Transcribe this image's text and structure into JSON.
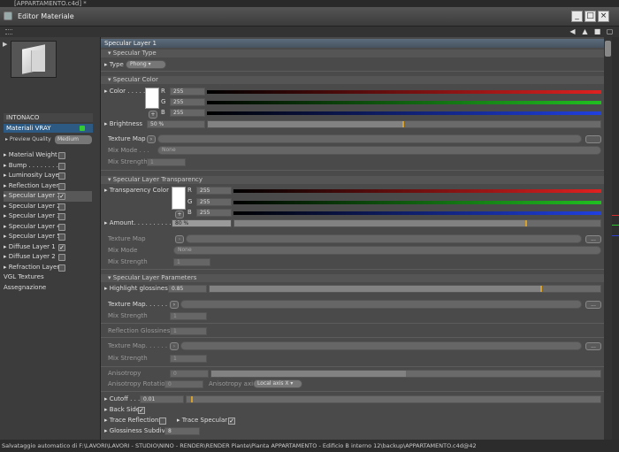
{
  "window": {
    "top_text": "[APPARTAMENTO.c4d] *",
    "title": "Editor Materiale"
  },
  "material": {
    "name": "INTONACO",
    "type_label": "Materiali VRAY",
    "preview_quality_label": "Preview Quality",
    "preview_quality_value": "Medium"
  },
  "channels": [
    {
      "label": "Material Weight",
      "checked": false
    },
    {
      "label": "Bump . . . . . . . . .",
      "checked": false
    },
    {
      "label": "Luminosity Layer",
      "checked": false
    },
    {
      "label": "Reflection Layer",
      "checked": false
    },
    {
      "label": "Specular Layer 1",
      "checked": true,
      "selected": true
    },
    {
      "label": "Specular Layer 2",
      "checked": false
    },
    {
      "label": "Specular Layer 3",
      "checked": false
    },
    {
      "label": "Specular Layer 4",
      "checked": false
    },
    {
      "label": "Specular Layer 5",
      "checked": false
    },
    {
      "label": "Diffuse Layer 1",
      "checked": true
    },
    {
      "label": "Diffuse Layer 2",
      "checked": false
    },
    {
      "label": "Refraction Layer",
      "checked": false
    },
    {
      "label": "VGL Textures",
      "checked": null
    },
    {
      "label": "Assegnazione",
      "checked": null
    }
  ],
  "main": {
    "section_title": "Specular Layer 1",
    "specular_type": {
      "header": "Specular Type",
      "label": "Type",
      "value": "Phong"
    },
    "specular_color": {
      "header": "Specular Color",
      "label": "Color . . . . . .",
      "r": "255",
      "g": "255",
      "b": "255",
      "r_lbl": "R",
      "g_lbl": "G",
      "b_lbl": "B",
      "brightness_label": "Brightness",
      "brightness": "50 %",
      "brightness_frac": 0.5,
      "texture_map": "Texture Map",
      "mix_mode_label": "Mix Mode . . .",
      "mix_mode": "None",
      "mix_strength_label": "Mix Strength",
      "mix_strength": "1"
    },
    "transparency": {
      "header": "Specular Layer Transparency",
      "label": "Transparency Color",
      "r": "255",
      "g": "255",
      "b": "255",
      "r_lbl": "R",
      "g_lbl": "G",
      "b_lbl": "B",
      "amount_label": "Amount. . . . . . . . . .",
      "amount": "80 %",
      "amount_frac": 0.8,
      "texture_map": "Texture Map",
      "mix_mode_label": "Mix Mode",
      "mix_mode": "None",
      "mix_strength_label": "Mix Strength",
      "mix_strength": "1"
    },
    "params": {
      "header": "Specular Layer Parameters",
      "hg_label": "Highlight glossiness",
      "hg": "0.85",
      "hg_frac": 0.85,
      "texture_map": "Texture Map. . . . . . . .",
      "mix_strength_label": "Mix Strength",
      "mix_strength": "1",
      "rg_label": "Reflection Glossiness",
      "rg": "1",
      "tm2": "Texture Map. . . . . .",
      "ms2_label": "Mix Strength",
      "ms2": "1",
      "anisotropy_label": "Anisotropy",
      "anisotropy": "0",
      "rot_label": "Anisotropy Rotation",
      "rot": "0",
      "axis_label": "Anisotropy axis",
      "axis": "Local axis X"
    },
    "cutoff_label": "Cutoff . . . . . .",
    "cutoff": "0.01",
    "backside_label": "Back Side",
    "trace_refl_label": "Trace Reflections",
    "trace_spec_label": "Trace Specular",
    "gloss_label": "Glossiness Subdivs",
    "gloss": "8"
  },
  "status": "Salvataggio automatico di F:\\LAVORI\\LAVORI - STUDIO\\NINO - RENDER\\RENDER Piante\\Pianta APPARTAMENTO - Edificio B interno 12\\backup\\APPARTAMENTO.c4d@42",
  "colors": {
    "accent": "#d7a02a",
    "selection": "#2d5a82",
    "red": "#e02020",
    "green": "#20c020",
    "blue": "#2040e0"
  }
}
